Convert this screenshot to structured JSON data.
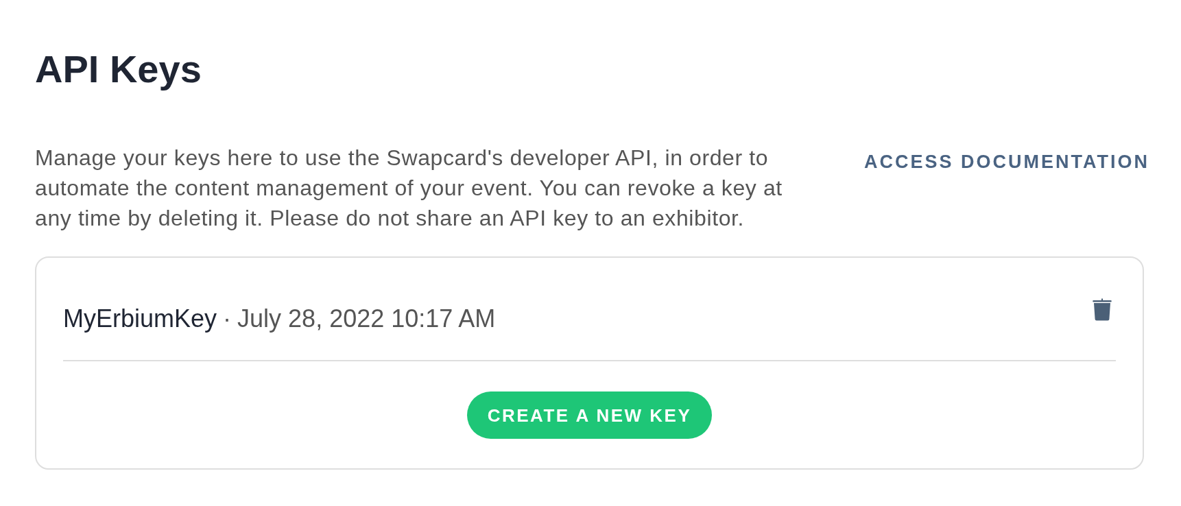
{
  "title": "API Keys",
  "intro": {
    "text": "Manage your keys here to use the Swapcard's developer API, in order to automate the content management of your event. You can revoke a key at any time by deleting it. Please do not share an API key to an exhibitor.",
    "link": "ACCESS DOCUMENTATION"
  },
  "keys": [
    {
      "name": "MyErbiumKey",
      "separator": "·",
      "created": "July 28, 2022 10:17 AM"
    }
  ],
  "create_button": "CREATE A NEW KEY"
}
